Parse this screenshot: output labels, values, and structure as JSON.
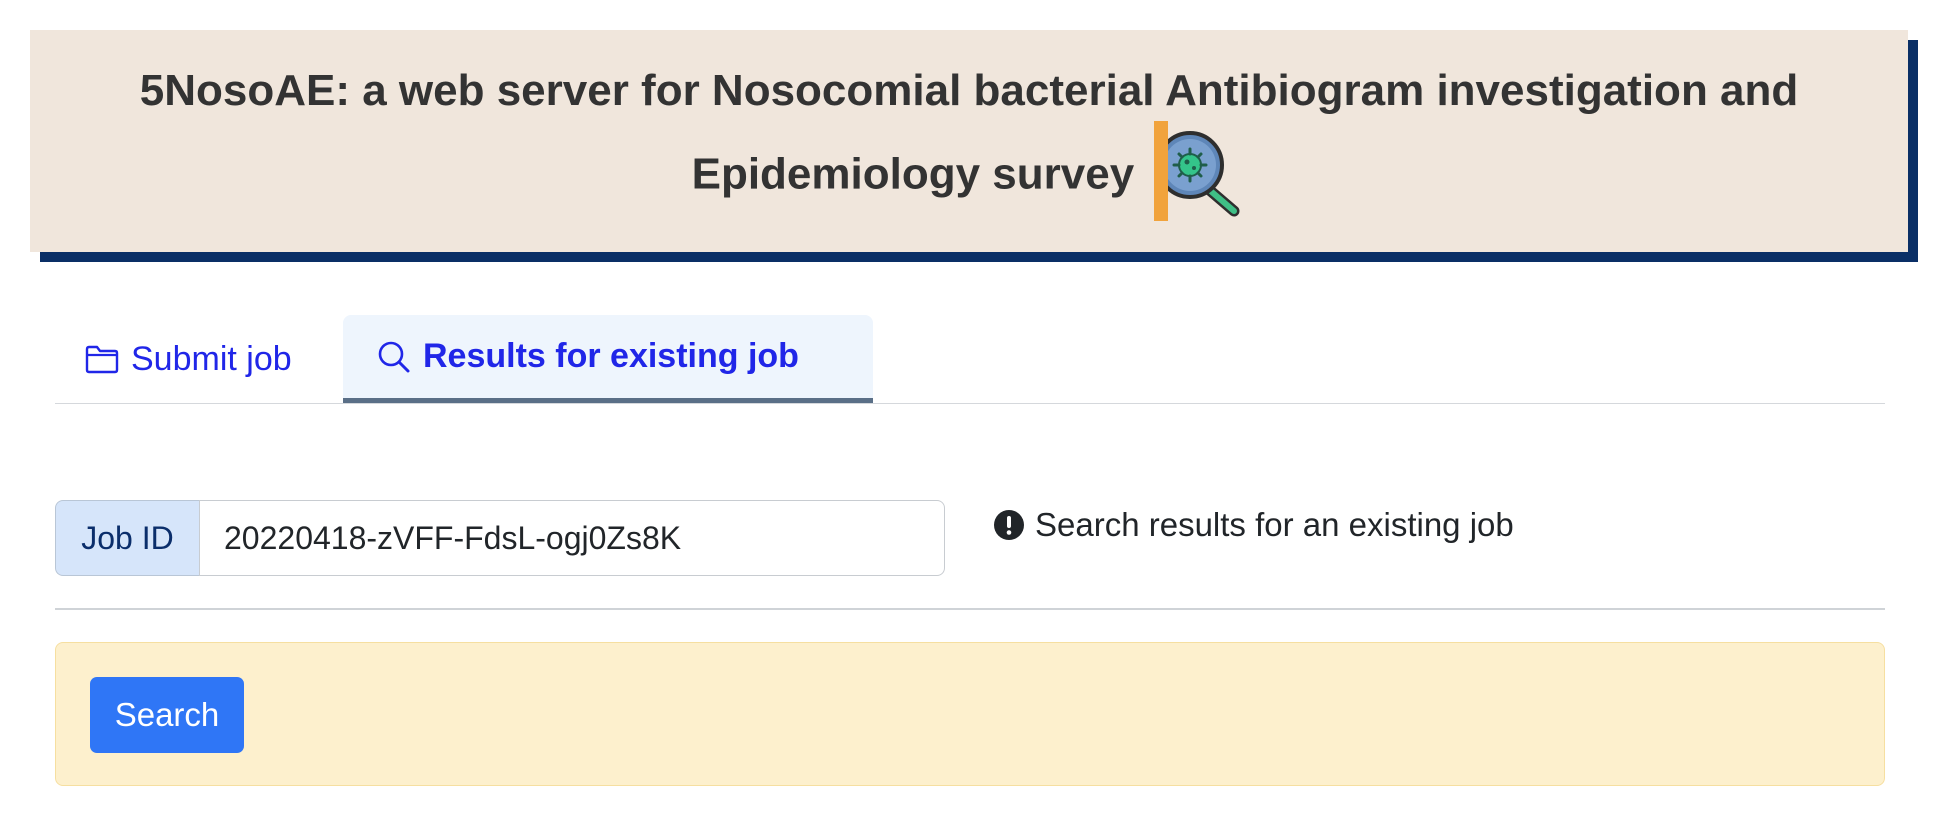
{
  "header": {
    "title_line1": "5NosoAE: a web server for Nosocomial bacterial Antibiogram investigation and",
    "title_line2": "Epidemiology survey",
    "icon": "magnifier-bacteria-icon"
  },
  "tabs": [
    {
      "label": "Submit job",
      "icon": "folder-icon",
      "active": false
    },
    {
      "label": "Results for existing job",
      "icon": "search-icon",
      "active": true
    }
  ],
  "job_form": {
    "label": "Job ID",
    "value": "20220418-zVFF-FdsL-ogj0Zs8K",
    "hint": "Search results for an existing job",
    "hint_icon": "exclamation-circle-icon"
  },
  "actions": {
    "search_label": "Search"
  },
  "colors": {
    "banner_bg": "#f0e6dc",
    "banner_shadow": "#0a2f66",
    "tab_text": "#2026e8",
    "button_primary": "#2f76f6",
    "panel_bg": "#fdf0cd"
  }
}
